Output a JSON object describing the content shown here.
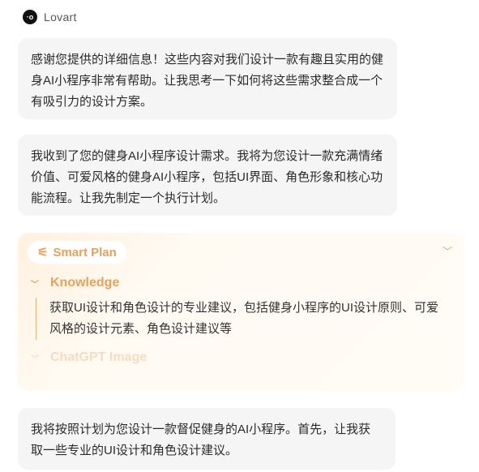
{
  "header": {
    "brand": "Lovart",
    "logo_text": "LO"
  },
  "messages": [
    {
      "text": "感谢您提供的详细信息！这些内容对我们设计一款有趣且实用的健身AI小程序非常有帮助。让我思考一下如何将这些需求整合成一个有吸引力的设计方案。"
    },
    {
      "text": "我收到了您的健身AI小程序设计需求。我将为您设计一款充满情绪价值、可爱风格的健身AI小程序，包括UI界面、角色形象和核心功能流程。让我先制定一个执行计划。"
    },
    {
      "text": "我将按照计划为您设计一款督促健身的AI小程序。首先，让我获取一些专业的UI设计和角色设计建议。"
    }
  ],
  "plan": {
    "title": "Smart Plan",
    "steps": [
      {
        "label": "Knowledge",
        "status": "active",
        "description": "获取UI设计和角色设计的专业建议，包括健身小程序的UI设计原则、可爱风格的设计元素、角色设计建议等"
      },
      {
        "label": "ChatGPT Image",
        "status": "pending"
      }
    ],
    "accent": "#e8a15a"
  }
}
